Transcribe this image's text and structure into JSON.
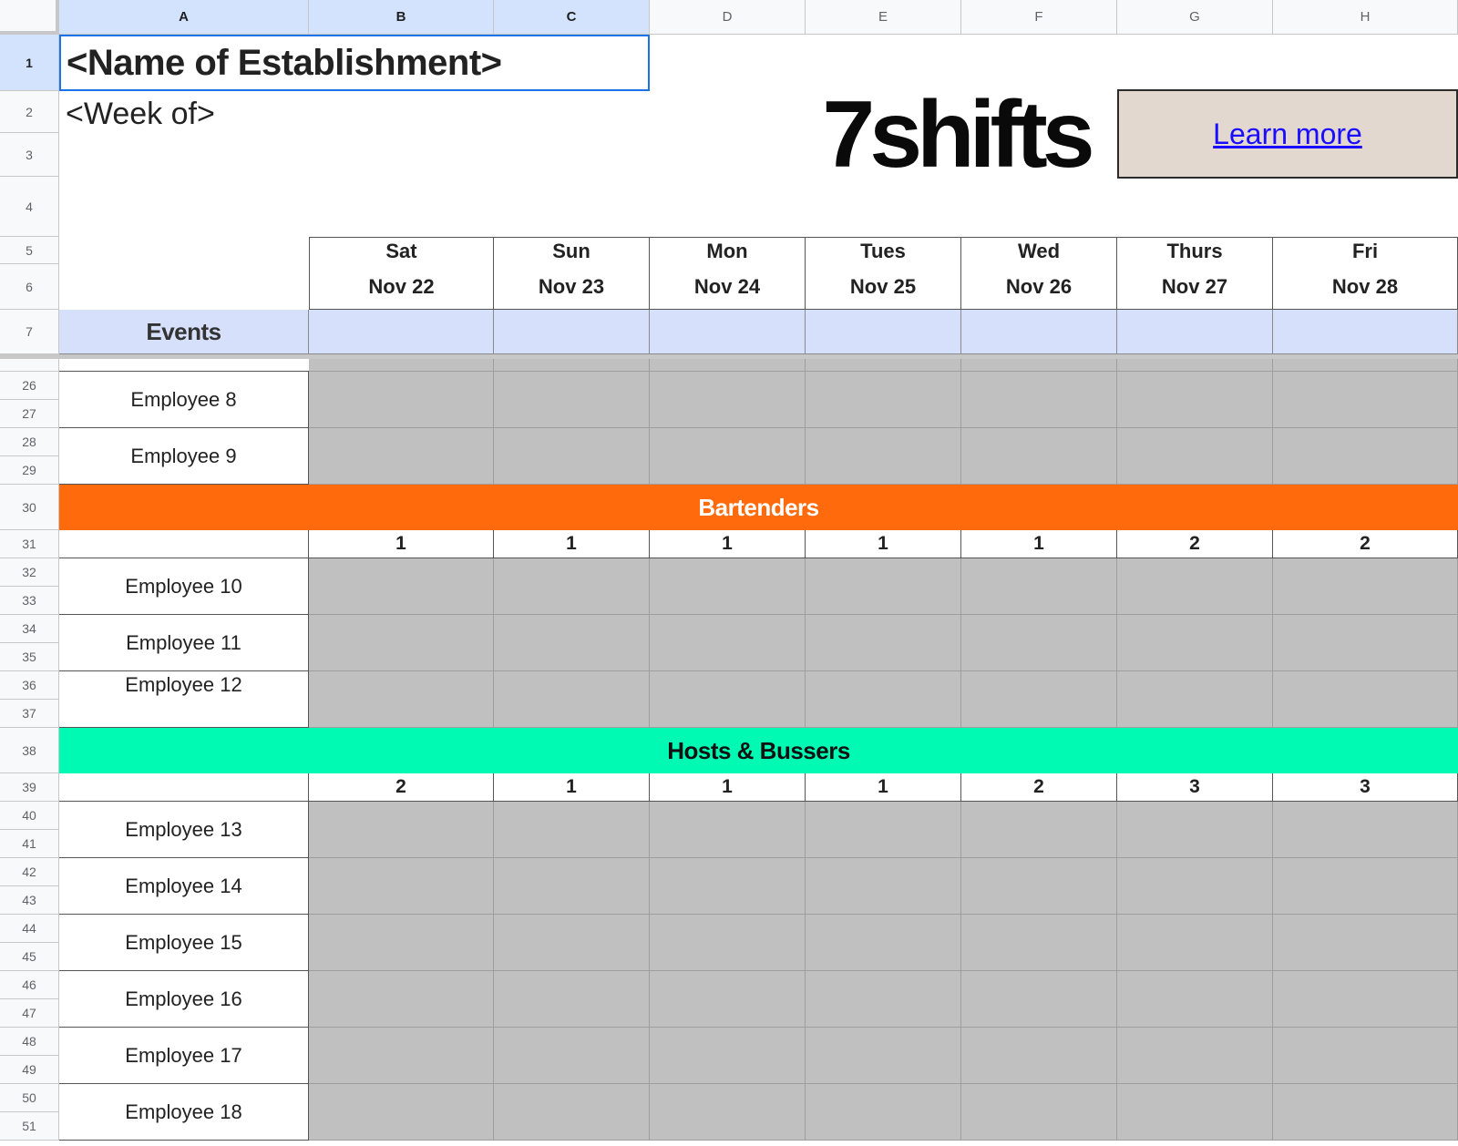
{
  "sheet": {
    "columns": [
      "A",
      "B",
      "C",
      "D",
      "E",
      "F",
      "G",
      "H"
    ],
    "title": "<Name of Establishment>",
    "subtitle": "<Week of>",
    "logo_text": "7shifts",
    "learn_more": "Learn more",
    "days": [
      {
        "day": "Sat",
        "date": "Nov 22"
      },
      {
        "day": "Sun",
        "date": "Nov 23"
      },
      {
        "day": "Mon",
        "date": "Nov 24"
      },
      {
        "day": "Tues",
        "date": "Nov 25"
      },
      {
        "day": "Wed",
        "date": "Nov 26"
      },
      {
        "day": "Thurs",
        "date": "Nov 27"
      },
      {
        "day": "Fri",
        "date": "Nov 28"
      }
    ],
    "events_label": "Events",
    "rows_top": [
      "1",
      "2",
      "3",
      "4",
      "5",
      "6",
      "7"
    ],
    "row_numbers": [
      "26",
      "27",
      "28",
      "29",
      "30",
      "31",
      "32",
      "33",
      "34",
      "35",
      "36",
      "37",
      "38",
      "39",
      "40",
      "41",
      "42",
      "43",
      "44",
      "45",
      "46",
      "47",
      "48",
      "49",
      "50",
      "51"
    ],
    "servers_tail": [
      "Employee 8",
      "Employee 9"
    ],
    "bartenders": {
      "label": "Bartenders",
      "color": "#ff6a0c",
      "counts": [
        "1",
        "1",
        "1",
        "1",
        "1",
        "2",
        "2"
      ],
      "employees": [
        "Employee 10",
        "Employee 11",
        "Employee 12"
      ]
    },
    "hosts": {
      "label": "Hosts & Bussers",
      "color": "#00fab4",
      "counts": [
        "2",
        "1",
        "1",
        "1",
        "2",
        "3",
        "3"
      ],
      "employees": [
        "Employee 13",
        "Employee 14",
        "Employee 15",
        "Employee 16",
        "Employee 17",
        "Employee 18"
      ]
    }
  }
}
